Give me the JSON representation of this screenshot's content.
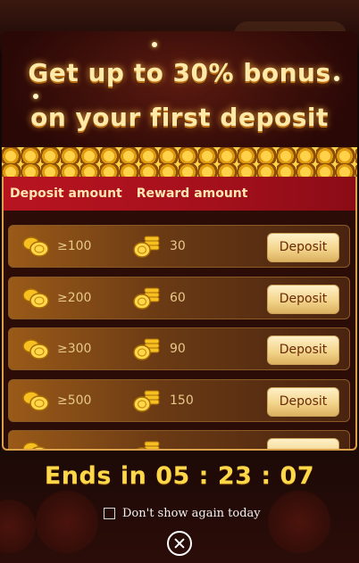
{
  "banner": {
    "line1": "Get up to 30% bonus",
    "line2": "on your first deposit"
  },
  "table": {
    "header_deposit": "Deposit amount",
    "header_reward": "Reward amount",
    "rows": [
      {
        "amount": "≥100",
        "reward": "30",
        "button": "Deposit"
      },
      {
        "amount": "≥200",
        "reward": "60",
        "button": "Deposit"
      },
      {
        "amount": "≥300",
        "reward": "90",
        "button": "Deposit"
      },
      {
        "amount": "≥500",
        "reward": "150",
        "button": "Deposit"
      },
      {
        "amount": "",
        "reward": "",
        "button": ""
      }
    ]
  },
  "countdown": "Ends in 05 : 23 : 07",
  "dont_show": "Don't show again today",
  "colors": {
    "header_bar": "#b81420",
    "button": "#f3d58c",
    "countdown": "#ffd84a"
  },
  "icons": [
    "gold-coin-stack-icon",
    "close-icon",
    "checkbox"
  ]
}
